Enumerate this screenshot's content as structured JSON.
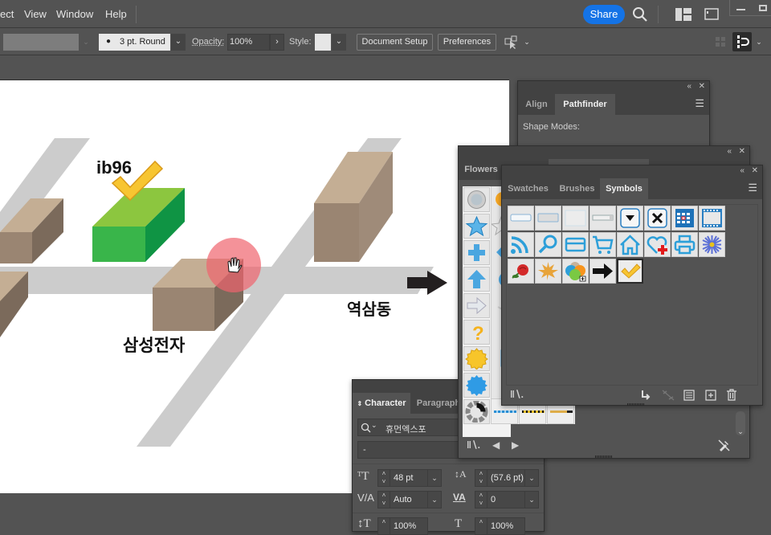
{
  "menubar": {
    "items": [
      "ect",
      "View",
      "Window",
      "Help"
    ],
    "share_label": "Share",
    "icons": [
      "search-icon",
      "arrange-documents-icon",
      "workspace-icon",
      "minimize-icon",
      "maximize-icon"
    ]
  },
  "controlbar": {
    "stroke_profile": "3 pt. Round",
    "opacity_label": "Opacity:",
    "opacity_value": "100%",
    "style_label": "Style:",
    "document_setup_label": "Document Setup",
    "preferences_label": "Preferences"
  },
  "artboard": {
    "labels": {
      "ib96": "ib96",
      "samsung": "삼성전자",
      "yeoksam": "역삼동"
    },
    "colors": {
      "road": "#cccccc",
      "building_top": "#c4ae94",
      "building_front": "#9a8572",
      "building_side": "#7b6a5b",
      "green_top": "#8cc63f",
      "green_front": "#39b54a",
      "green_side": "#0f9444",
      "cursor_highlight": "#f0646e"
    }
  },
  "pathfinder_panel": {
    "tabs": [
      "Align",
      "Pathfinder"
    ],
    "active_tab": "Pathfinder",
    "shape_modes_label": "Shape Modes:"
  },
  "flowers_panel": {
    "tabs": [
      "Flowers"
    ],
    "symbols": [
      "globe-button",
      "star",
      "plus",
      "arrow-up",
      "arrow-right",
      "question",
      "yellow-burst",
      "blue-burst",
      "loading-spinner"
    ],
    "brush_strokes": [
      "blue-dash-brush",
      "yellow-dash-brush",
      "gold-brush"
    ]
  },
  "symbols_panel": {
    "tabs": [
      "Swatches",
      "Brushes",
      "Symbols"
    ],
    "active_tab": "Symbols",
    "symbols": [
      "button-plain",
      "button-gray",
      "button-blank",
      "dropdown-field",
      "dropdown-arrow",
      "close-x",
      "calendar",
      "film-frame",
      "rss",
      "magnifier",
      "credit-card",
      "shopping-cart",
      "home",
      "heart-plus",
      "printer",
      "blue-flower",
      "rose",
      "maple-leaf",
      "color-circles",
      "black-arrow",
      "checkmark"
    ],
    "selected_symbol": "checkmark"
  },
  "character_panel": {
    "tabs": [
      "Character",
      "Paragraph"
    ],
    "active_tab": "Character",
    "font_family": "휴먼엑스포",
    "font_style": "-",
    "font_size": "48 pt",
    "leading": "(57.6 pt)",
    "kerning": "Auto",
    "tracking": "0",
    "vertical_scale": "100%",
    "horizontal_scale": "100%"
  }
}
